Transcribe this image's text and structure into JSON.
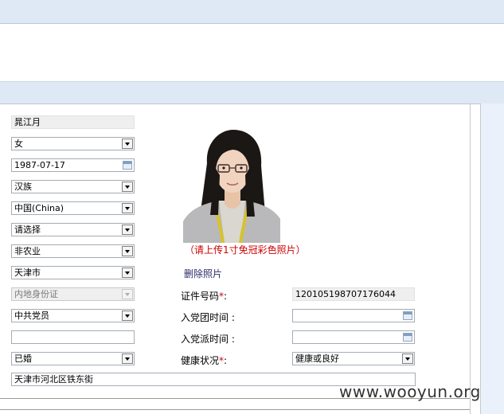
{
  "form": {
    "name": "晁江月",
    "gender": "女",
    "birth_date": "1987-07-17",
    "ethnicity": "汉族",
    "nationality": "中国(China)",
    "select_placeholder": "请选择",
    "household_type": "非农业",
    "region": "天津市",
    "id_type": "内地身份证",
    "political_status": "中共党员",
    "blank_field": "",
    "marital_status": "已婚",
    "address": "天津市河北区铁东街"
  },
  "photo": {
    "note": "（请上传1寸免冠彩色照片）",
    "delete_link": "删除照片"
  },
  "right_fields": {
    "id_number_label": "证件号码",
    "id_number_value": "120105198707176044",
    "league_join_label": "入党团时间 :",
    "party_join_label": "入党派时间 :",
    "health_label": "健康状况",
    "health_value": "健康或良好",
    "required_mark": "*",
    "colon": ":"
  },
  "watermark": "www.wooyun.org"
}
